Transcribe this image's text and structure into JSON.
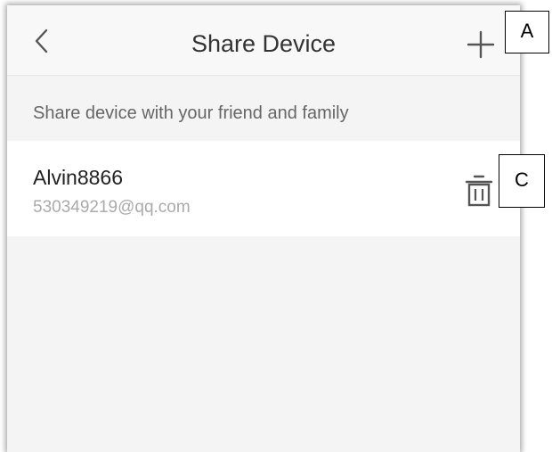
{
  "header": {
    "title": "Share Device",
    "back_icon": "chevron-left-icon",
    "add_icon": "plus-icon"
  },
  "subtitle": "Share device with your friend and family",
  "shared_users": [
    {
      "name": "Alvin8866",
      "email": "530349219@qq.com",
      "delete_icon": "trash-icon"
    }
  ],
  "annotations": {
    "a": "A",
    "c": "C"
  },
  "colors": {
    "background": "#f4f4f4",
    "header": "#f8f8f8",
    "row": "#ffffff",
    "icon": "#555555"
  }
}
